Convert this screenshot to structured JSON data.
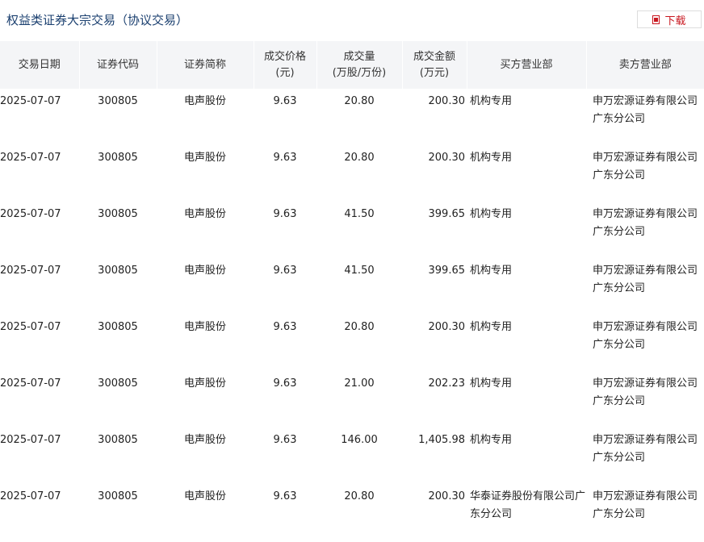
{
  "header": {
    "title": "权益类证券大宗交易（协议交易）",
    "download_label": "下载",
    "accent_color": "#c8161e",
    "title_color": "#1a3f6f"
  },
  "columns": [
    {
      "line1": "交易日期",
      "line2": ""
    },
    {
      "line1": "证券代码",
      "line2": ""
    },
    {
      "line1": "证券简称",
      "line2": ""
    },
    {
      "line1": "成交价格",
      "line2": "(元)"
    },
    {
      "line1": "成交量",
      "line2": "(万股/万份)"
    },
    {
      "line1": "成交金额",
      "line2": "(万元)"
    },
    {
      "line1": "买方营业部",
      "line2": ""
    },
    {
      "line1": "卖方营业部",
      "line2": ""
    }
  ],
  "rows": [
    {
      "date": "2025-07-07",
      "code": "300805",
      "name": "电声股份",
      "price": "9.63",
      "volume": "20.80",
      "amount": "200.30",
      "buyer": "机构专用",
      "seller": "申万宏源证券有限公司广东分公司"
    },
    {
      "date": "2025-07-07",
      "code": "300805",
      "name": "电声股份",
      "price": "9.63",
      "volume": "20.80",
      "amount": "200.30",
      "buyer": "机构专用",
      "seller": "申万宏源证券有限公司广东分公司"
    },
    {
      "date": "2025-07-07",
      "code": "300805",
      "name": "电声股份",
      "price": "9.63",
      "volume": "41.50",
      "amount": "399.65",
      "buyer": "机构专用",
      "seller": "申万宏源证券有限公司广东分公司"
    },
    {
      "date": "2025-07-07",
      "code": "300805",
      "name": "电声股份",
      "price": "9.63",
      "volume": "41.50",
      "amount": "399.65",
      "buyer": "机构专用",
      "seller": "申万宏源证券有限公司广东分公司"
    },
    {
      "date": "2025-07-07",
      "code": "300805",
      "name": "电声股份",
      "price": "9.63",
      "volume": "20.80",
      "amount": "200.30",
      "buyer": "机构专用",
      "seller": "申万宏源证券有限公司广东分公司"
    },
    {
      "date": "2025-07-07",
      "code": "300805",
      "name": "电声股份",
      "price": "9.63",
      "volume": "21.00",
      "amount": "202.23",
      "buyer": "机构专用",
      "seller": "申万宏源证券有限公司广东分公司"
    },
    {
      "date": "2025-07-07",
      "code": "300805",
      "name": "电声股份",
      "price": "9.63",
      "volume": "146.00",
      "amount": "1,405.98",
      "buyer": "机构专用",
      "seller": "申万宏源证券有限公司广东分公司"
    },
    {
      "date": "2025-07-07",
      "code": "300805",
      "name": "电声股份",
      "price": "9.63",
      "volume": "20.80",
      "amount": "200.30",
      "buyer": "华泰证券股份有限公司广东分公司",
      "seller": "申万宏源证券有限公司广东分公司"
    }
  ]
}
